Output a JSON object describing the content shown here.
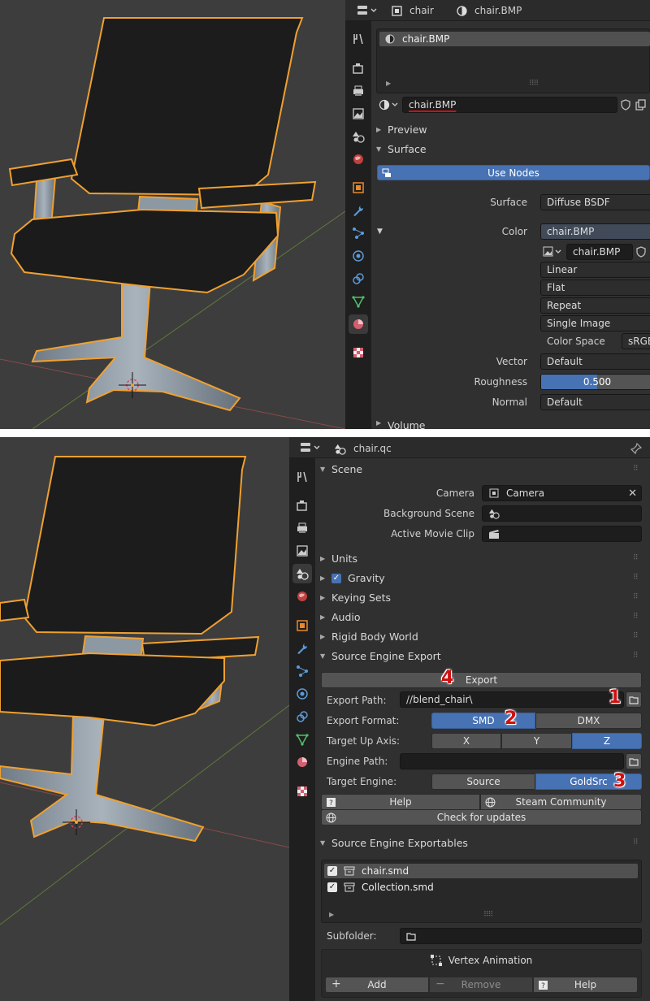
{
  "top": {
    "header": {
      "object_name": "chair",
      "material_name": "chair.BMP"
    },
    "slot_list": {
      "item": "chair.BMP"
    },
    "material_field": {
      "value": "chair.BMP"
    },
    "preview_label": "Preview",
    "surface_label": "Surface",
    "use_nodes_label": "Use Nodes",
    "surface_row": {
      "label": "Surface",
      "value": "Diffuse BSDF"
    },
    "color_row": {
      "label": "Color",
      "value": "chair.BMP"
    },
    "image_field": "chair.BMP",
    "options": [
      "Linear",
      "Flat",
      "Repeat",
      "Single Image"
    ],
    "color_space": {
      "label": "Color Space",
      "value": "sRGB"
    },
    "vector": {
      "label": "Vector",
      "value": "Default"
    },
    "roughness": {
      "label": "Roughness",
      "value": "0.500",
      "fraction": 0.5
    },
    "normal": {
      "label": "Normal",
      "value": "Default"
    },
    "volume_label": "Volume"
  },
  "bottom": {
    "header": {
      "file_name": "chair.qc"
    },
    "scene_label": "Scene",
    "camera": {
      "label": "Camera",
      "value": "Camera"
    },
    "background_scene_label": "Background Scene",
    "active_movie_clip_label": "Active Movie Clip",
    "units_label": "Units",
    "gravity_label": "Gravity",
    "keying_sets_label": "Keying Sets",
    "audio_label": "Audio",
    "rigid_body_world_label": "Rigid Body World",
    "source_export_label": "Source Engine Export",
    "export_button": "Export",
    "export_path": {
      "label": "Export Path:",
      "value": "//blend_chair\\"
    },
    "export_format": {
      "label": "Export Format:",
      "options": [
        "SMD",
        "DMX"
      ],
      "selected": "SMD"
    },
    "target_up_axis": {
      "label": "Target Up Axis:",
      "options": [
        "X",
        "Y",
        "Z"
      ],
      "selected": "Z"
    },
    "engine_path_label": "Engine Path:",
    "target_engine": {
      "label": "Target Engine:",
      "options": [
        "Source",
        "GoldSrc"
      ],
      "selected": "GoldSrc"
    },
    "help_label": "Help",
    "steam_community_label": "Steam Community",
    "check_updates_label": "Check for updates",
    "exportables_label": "Source Engine Exportables",
    "exportables": [
      "chair.smd",
      "Collection.smd"
    ],
    "subfolder_label": "Subfolder:",
    "vertex_animation_label": "Vertex Animation",
    "add_label": "Add",
    "remove_label": "Remove",
    "help2_label": "Help",
    "annotations": [
      "1",
      "2",
      "3",
      "4"
    ]
  },
  "colors": {
    "accent": "#4772b3",
    "selection": "#f0a030",
    "annotation": "#d01010"
  }
}
